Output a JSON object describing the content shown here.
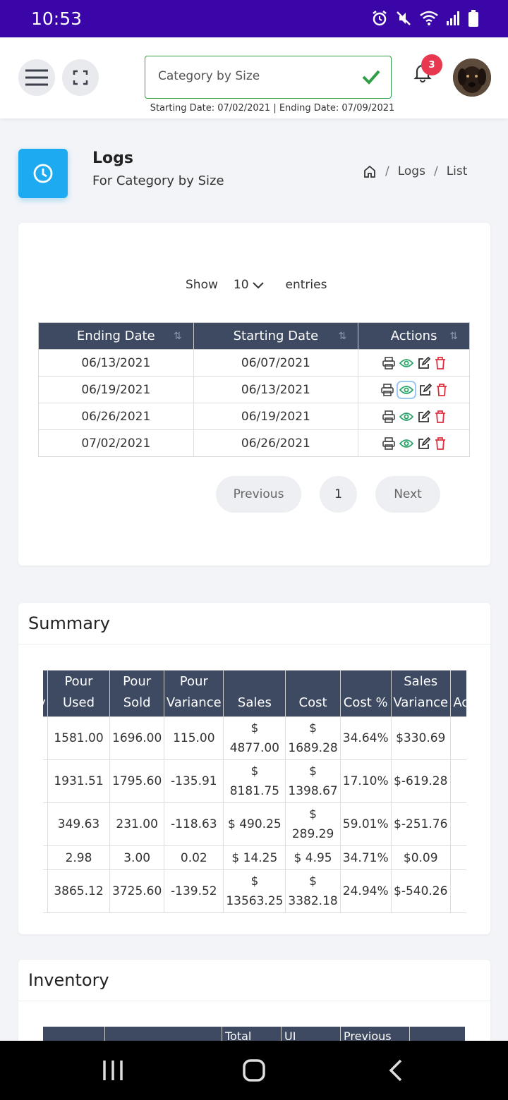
{
  "status_bar": {
    "time": "10:53"
  },
  "header": {
    "category": "Category by Size",
    "date_range": "Starting Date: 07/02/2021 | Ending Date: 07/09/2021",
    "notification_count": "3"
  },
  "page": {
    "title": "Logs",
    "subtitle": "For Category by Size",
    "breadcrumb": [
      "Logs",
      "List"
    ]
  },
  "logs": {
    "show_label": "Show",
    "show_value": "10",
    "entries_label": "entries",
    "columns": [
      "Ending Date",
      "Starting Date",
      "Actions"
    ],
    "rows": [
      {
        "ending": "06/13/2021",
        "starting": "06/07/2021"
      },
      {
        "ending": "06/19/2021",
        "starting": "06/13/2021"
      },
      {
        "ending": "06/26/2021",
        "starting": "06/19/2021"
      },
      {
        "ending": "07/02/2021",
        "starting": "06/26/2021"
      }
    ],
    "pagination": {
      "previous": "Previous",
      "page": "1",
      "next": "Next"
    }
  },
  "summary": {
    "title": "Summary",
    "columns": [
      "y",
      "Pour Used",
      "Pour Sold",
      "Pour Variance",
      "Sales",
      "Cost",
      "Cost %",
      "Sales Variance",
      "Acc"
    ],
    "rows": [
      [
        "",
        "1581.00",
        "1696.00",
        "115.00",
        "$ 4877.00",
        "$ 1689.28",
        "34.64%",
        "$330.69",
        ""
      ],
      [
        "",
        "1931.51",
        "1795.60",
        "-135.91",
        "$ 8181.75",
        "$ 1398.67",
        "17.10%",
        "$-619.28",
        ""
      ],
      [
        "",
        "349.63",
        "231.00",
        "-118.63",
        "$ 490.25",
        "$ 289.29",
        "59.01%",
        "$-251.76",
        ""
      ],
      [
        "",
        "2.98",
        "3.00",
        "0.02",
        "$ 14.25",
        "$ 4.95",
        "34.71%",
        "$0.09",
        ""
      ],
      [
        "",
        "3865.12",
        "3725.60",
        "-139.52",
        "$ 13563.25",
        "$ 3382.18",
        "24.94%",
        "$-540.26",
        ""
      ]
    ]
  },
  "inventory": {
    "title": "Inventory",
    "columns": [
      "",
      "",
      "Total",
      "UI",
      "Previous",
      ""
    ]
  },
  "colors": {
    "status_bar": "#3a06a8",
    "accent_blue": "#1eaaf1",
    "table_header": "#3e4a62",
    "success_green": "#2e9e47",
    "danger_red": "#e8384f"
  }
}
